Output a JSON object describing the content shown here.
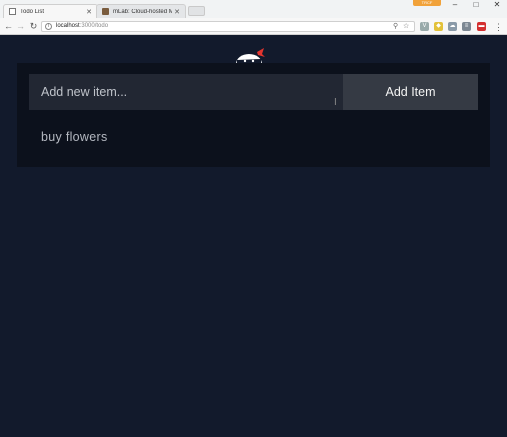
{
  "browser": {
    "tabs": [
      {
        "label": "Todo List"
      },
      {
        "label": "mLab: Cloud-hosted Mo"
      }
    ],
    "profile_label": "TRCF",
    "address": {
      "host": "localhost",
      "path": ":3000/todo"
    }
  },
  "app": {
    "input": {
      "placeholder": "Add new item...",
      "value": ""
    },
    "add_button_label": "Add Item",
    "items": [
      {
        "text": "buy flowers"
      }
    ]
  }
}
